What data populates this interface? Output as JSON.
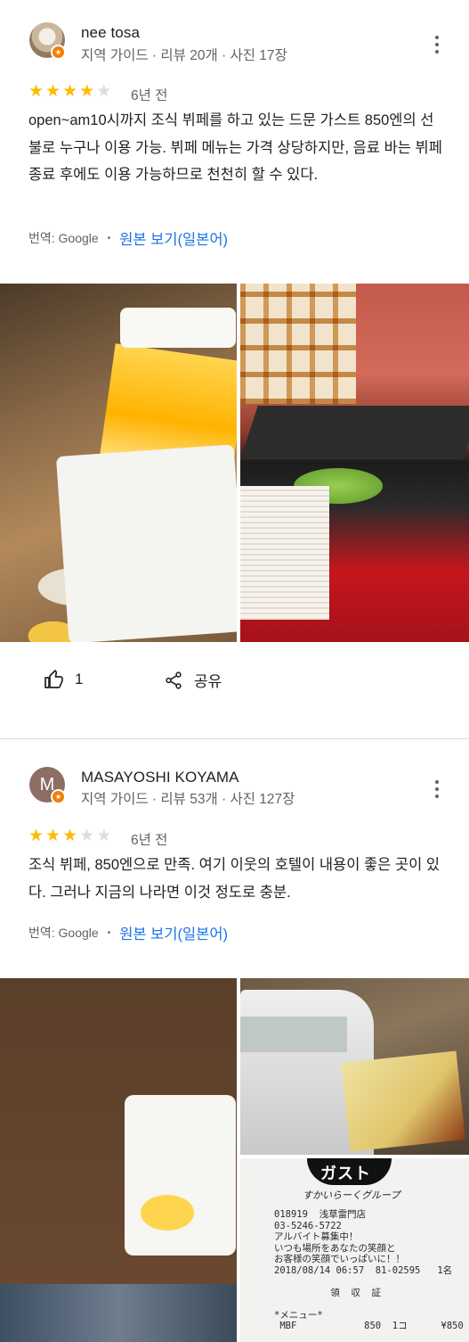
{
  "reviews": [
    {
      "reviewer": "nee tosa",
      "meta": "지역 가이드 · 리뷰 20개 · 사진 17장",
      "rating": 4,
      "time": "6년 전",
      "text": "open~am10시까지 조식 뷔페를 하고 있는 드문 가스트 850엔의 선불로 누구나 이용 가능. 뷔페 메뉴는 가격 상당하지만, 음료 바는 뷔페 종료 후에도 이용 가능하므로 천천히 할 수 있다.",
      "translated_by": "번역: Google",
      "original_link": "원본 보기(일본어)",
      "likes": "1",
      "share": "공유"
    },
    {
      "reviewer": "MASAYOSHI KOYAMA",
      "avatar_letter": "M",
      "meta": "지역 가이드 · 리뷰 53개 · 사진 127장",
      "rating": 3,
      "time": "6년 전",
      "text": "조식 뷔페, 850엔으로 만족. 여기 이웃의 호텔이 내용이 좋은 곳이 있다. 그러나 지금의 나라면 이것 정도로 충분.",
      "translated_by": "번역: Google",
      "original_link": "원본 보기(일본어)"
    }
  ],
  "receipt": {
    "logo": "ガスト",
    "sub_logo": "すかいらーくグループ",
    "lines": "018919  浅草雷門店\n03-5246-5722\nアルバイト募集中！\nいつも場所をあなたの笑顔と\nお客様の笑顔でいっぱいに！！\n2018/08/14 06:57  81-02595   1名\n\n          領  収  証\n\n*メニュー*\n MBF            850  1コ      ¥850"
  },
  "colors": {
    "star": "#fbbc04",
    "link": "#1a73e8",
    "badge": "#f57c00"
  }
}
